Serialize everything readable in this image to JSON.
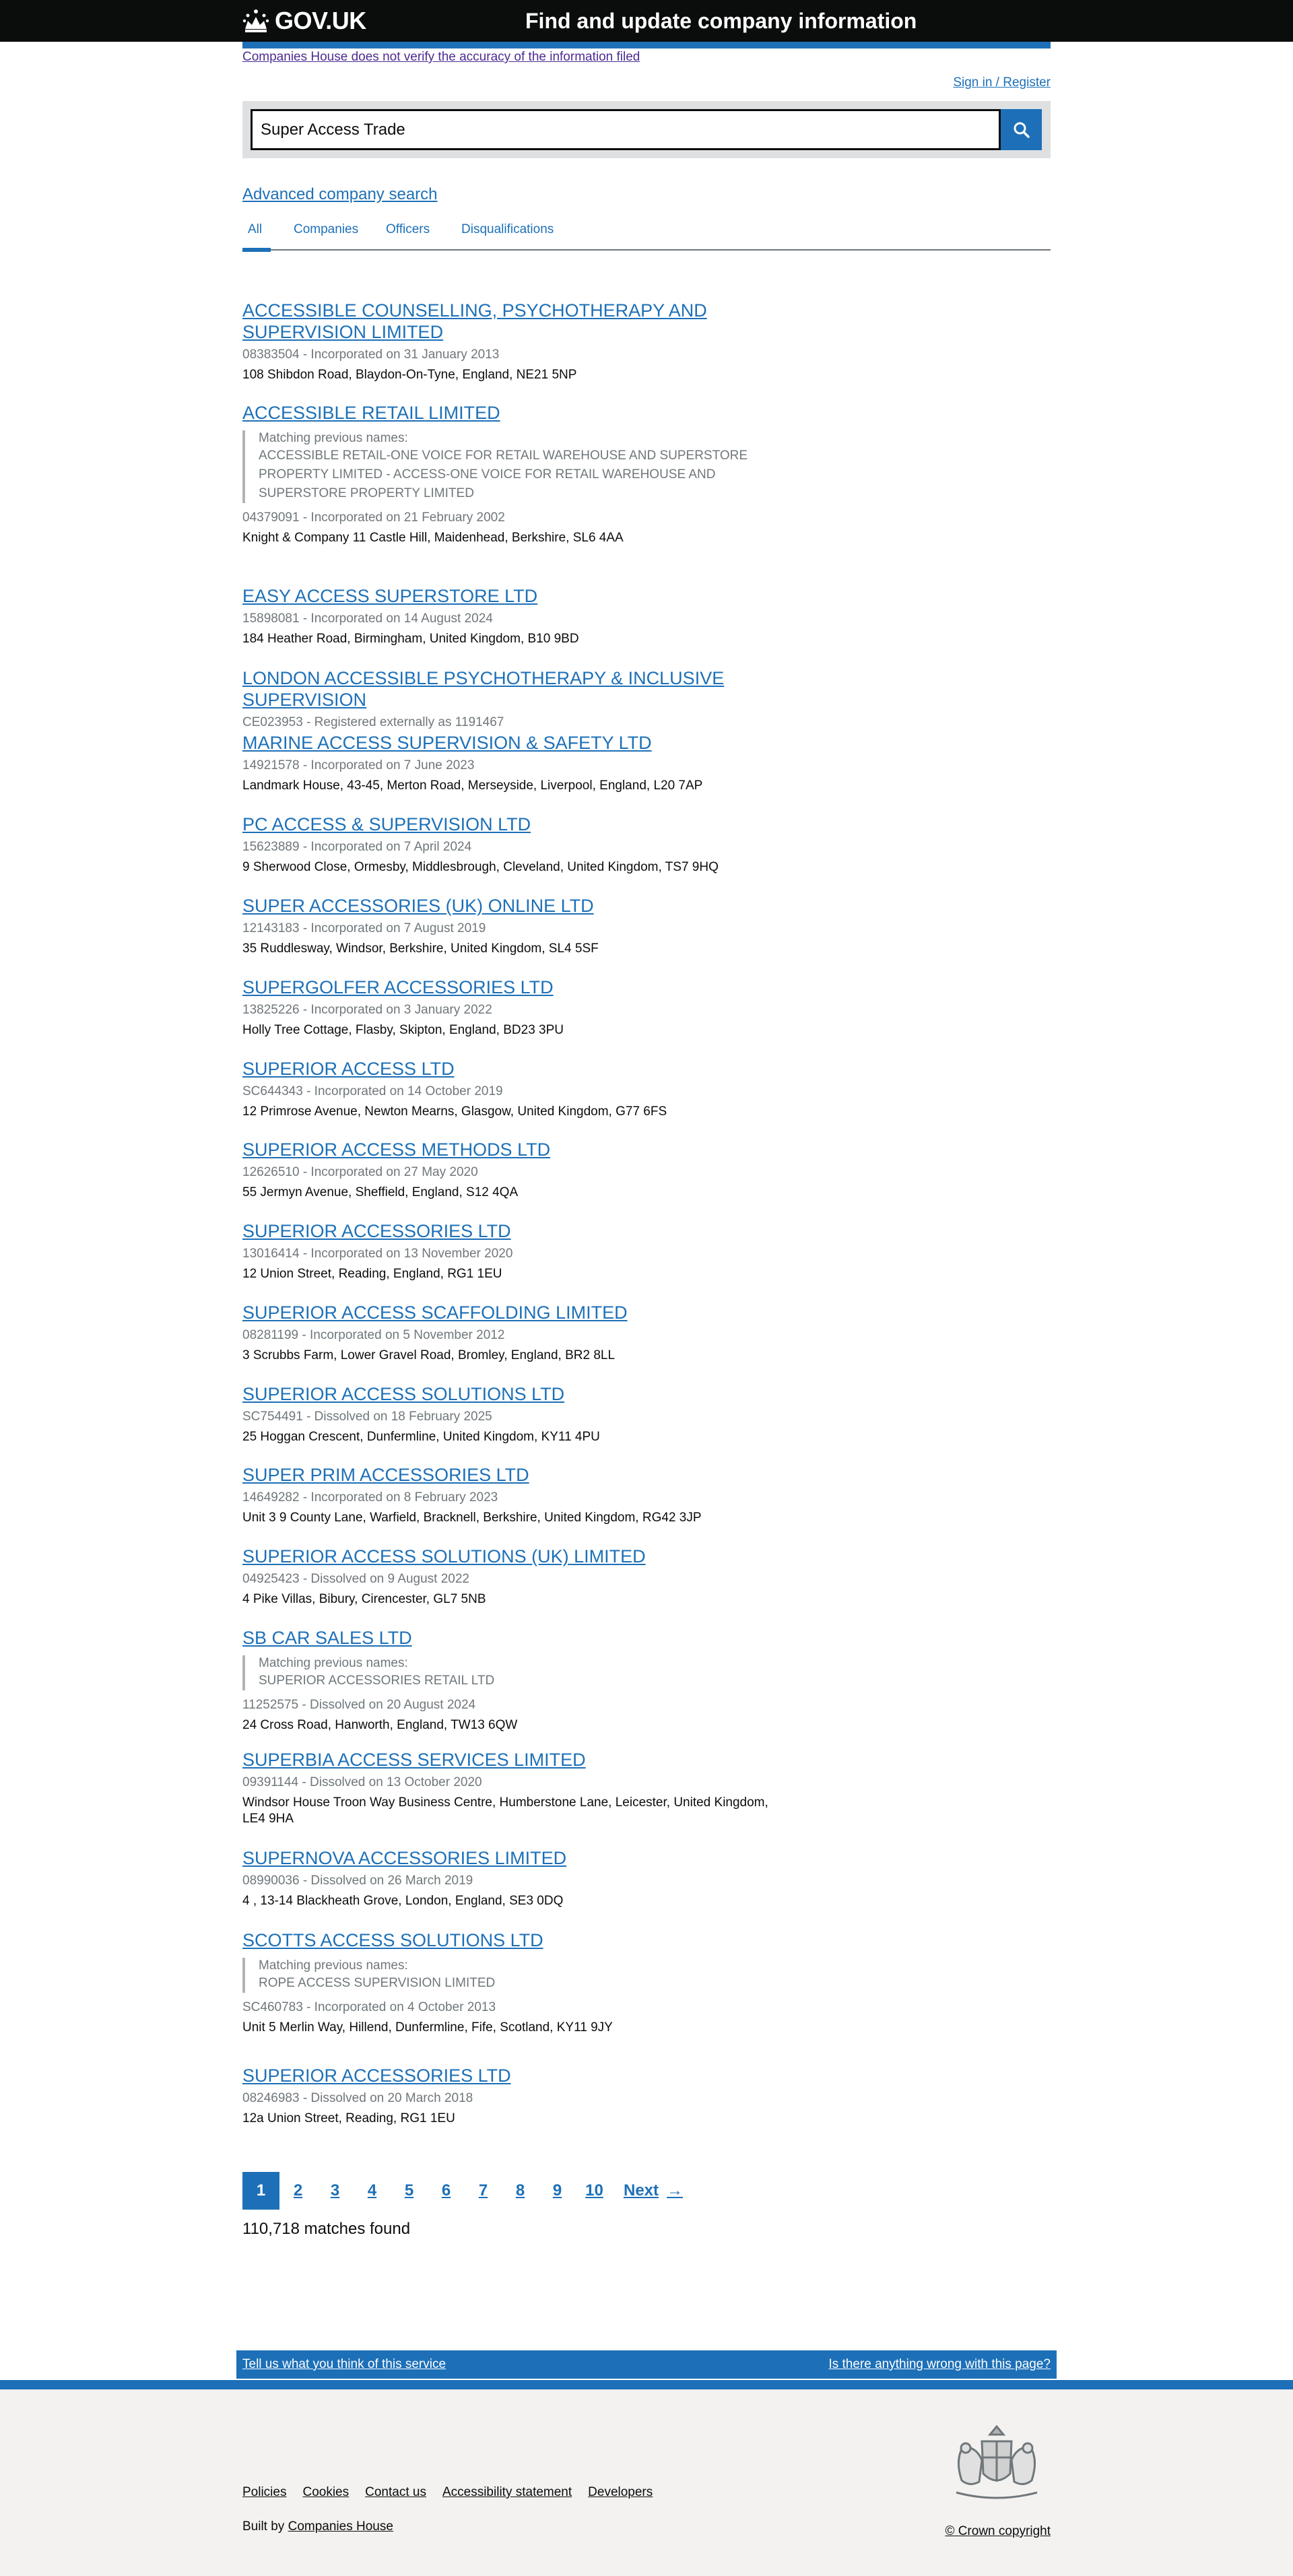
{
  "header": {
    "logo_text": "GOV.UK",
    "service_name": "Find and update company information"
  },
  "disclaimer": "Companies House does not verify the accuracy of the information filed",
  "signin": "Sign in / Register",
  "search": {
    "value": "Super Access Trade"
  },
  "advanced_search": "Advanced company search",
  "tabs": [
    "All",
    "Companies",
    "Officers",
    "Disqualifications"
  ],
  "results": [
    {
      "title": "ACCESSIBLE COUNSELLING, PSYCHOTHERAPY AND SUPERVISION LIMITED",
      "meta": "08383504 - Incorporated on 31 January 2013",
      "address": "108 Shibdon Road, Blaydon-On-Tyne, England, NE21 5NP"
    },
    {
      "title": "ACCESSIBLE RETAIL LIMITED",
      "prev_label": "Matching previous names:",
      "prev_value": "ACCESSIBLE RETAIL-ONE VOICE FOR RETAIL WAREHOUSE AND SUPERSTORE PROPERTY LIMITED - ACCESS-ONE VOICE FOR RETAIL WAREHOUSE AND SUPERSTORE PROPERTY LIMITED",
      "meta": "04379091 - Incorporated on 21 February 2002",
      "address": "Knight & Company 11 Castle Hill, Maidenhead, Berkshire, SL6 4AA"
    },
    {
      "title": "EASY ACCESS SUPERSTORE LTD",
      "meta": "15898081 - Incorporated on 14 August 2024",
      "address": "184 Heather Road, Birmingham, United Kingdom, B10 9BD"
    },
    {
      "title": "LONDON ACCESSIBLE PSYCHOTHERAPY & INCLUSIVE SUPERVISION",
      "meta": "CE023953 - Registered externally as 1191467",
      "address": ""
    },
    {
      "title": "MARINE ACCESS SUPERVISION & SAFETY LTD",
      "meta": "14921578 - Incorporated on 7 June 2023",
      "address": "Landmark House, 43-45, Merton Road, Merseyside, Liverpool, England, L20 7AP"
    },
    {
      "title": "PC ACCESS & SUPERVISION LTD",
      "meta": "15623889 - Incorporated on 7 April 2024",
      "address": "9 Sherwood Close, Ormesby, Middlesbrough, Cleveland, United Kingdom, TS7 9HQ"
    },
    {
      "title": "SUPER ACCESSORIES (UK) ONLINE LTD",
      "meta": "12143183 - Incorporated on 7 August 2019",
      "address": "35 Ruddlesway, Windsor, Berkshire, United Kingdom, SL4 5SF"
    },
    {
      "title": "SUPERGOLFER ACCESSORIES LTD",
      "meta": "13825226 - Incorporated on 3 January 2022",
      "address": "Holly Tree Cottage, Flasby, Skipton, England, BD23 3PU"
    },
    {
      "title": "SUPERIOR ACCESS LTD",
      "meta": "SC644343 - Incorporated on 14 October 2019",
      "address": "12 Primrose Avenue, Newton Mearns, Glasgow, United Kingdom, G77 6FS"
    },
    {
      "title": "SUPERIOR ACCESS METHODS LTD",
      "meta": "12626510 - Incorporated on 27 May 2020",
      "address": "55 Jermyn Avenue, Sheffield, England, S12 4QA"
    },
    {
      "title": "SUPERIOR ACCESSORIES LTD",
      "meta": "13016414 - Incorporated on 13 November 2020",
      "address": "12 Union Street, Reading, England, RG1 1EU"
    },
    {
      "title": "SUPERIOR ACCESS SCAFFOLDING LIMITED",
      "meta": "08281199 - Incorporated on 5 November 2012",
      "address": "3 Scrubbs Farm, Lower Gravel Road, Bromley, England, BR2 8LL"
    },
    {
      "title": "SUPERIOR ACCESS SOLUTIONS LTD",
      "meta": "SC754491 - Dissolved on 18 February 2025",
      "address": "25 Hoggan Crescent, Dunfermline, United Kingdom, KY11 4PU"
    },
    {
      "title": "SUPER PRIM ACCESSORIES LTD",
      "meta": "14649282 - Incorporated on 8 February 2023",
      "address": "Unit 3 9 County Lane, Warfield, Bracknell, Berkshire, United Kingdom, RG42 3JP"
    },
    {
      "title": "SUPERIOR ACCESS SOLUTIONS (UK) LIMITED",
      "meta": "04925423 - Dissolved on 9 August 2022",
      "address": "4 Pike Villas, Bibury, Cirencester, GL7 5NB"
    },
    {
      "title": "SB CAR SALES LTD",
      "prev_label": "Matching previous names:",
      "prev_value": "SUPERIOR ACCESSORIES RETAIL LTD",
      "meta": "11252575 - Dissolved on 20 August 2024",
      "address": "24 Cross Road, Hanworth, England, TW13 6QW"
    },
    {
      "title": "SUPERBIA ACCESS SERVICES LIMITED",
      "meta": "09391144 - Dissolved on 13 October 2020",
      "address": "Windsor House Troon Way Business Centre, Humberstone Lane, Leicester, United Kingdom, LE4 9HA"
    },
    {
      "title": "SUPERNOVA ACCESSORIES LIMITED",
      "meta": "08990036 - Dissolved on 26 March 2019",
      "address": "4 , 13-14 Blackheath Grove, London, England, SE3 0DQ"
    },
    {
      "title": "SCOTTS ACCESS SOLUTIONS LTD",
      "prev_label": "Matching previous names:",
      "prev_value": "ROPE ACCESS SUPERVISION LIMITED",
      "meta": "SC460783 - Incorporated on 4 October 2013",
      "address": "Unit 5 Merlin Way, Hillend, Dunfermline, Fife, Scotland, KY11 9JY"
    },
    {
      "title": "SUPERIOR ACCESSORIES LTD",
      "meta": "08246983 - Dissolved on 20 March 2018",
      "address": "12a Union Street, Reading, RG1 1EU"
    }
  ],
  "pagination": {
    "pages": [
      "1",
      "2",
      "3",
      "4",
      "5",
      "6",
      "7",
      "8",
      "9",
      "10"
    ],
    "current": "1",
    "next_label": "Next"
  },
  "matches": "110,718 matches found",
  "feedback": {
    "left": "Tell us what you think of this service",
    "right": "Is there anything wrong with this page?"
  },
  "footer": {
    "links": [
      "Policies",
      "Cookies",
      "Contact us",
      "Accessibility statement",
      "Developers"
    ],
    "built_by_prefix": "Built by",
    "built_by_link": "Companies House",
    "copyright": "© Crown copyright"
  },
  "colors": {
    "header_bg": "#0b0c0c",
    "link": "#1d70b8",
    "meta_text": "#6f777b",
    "footer_bg": "#f3f2f1"
  }
}
